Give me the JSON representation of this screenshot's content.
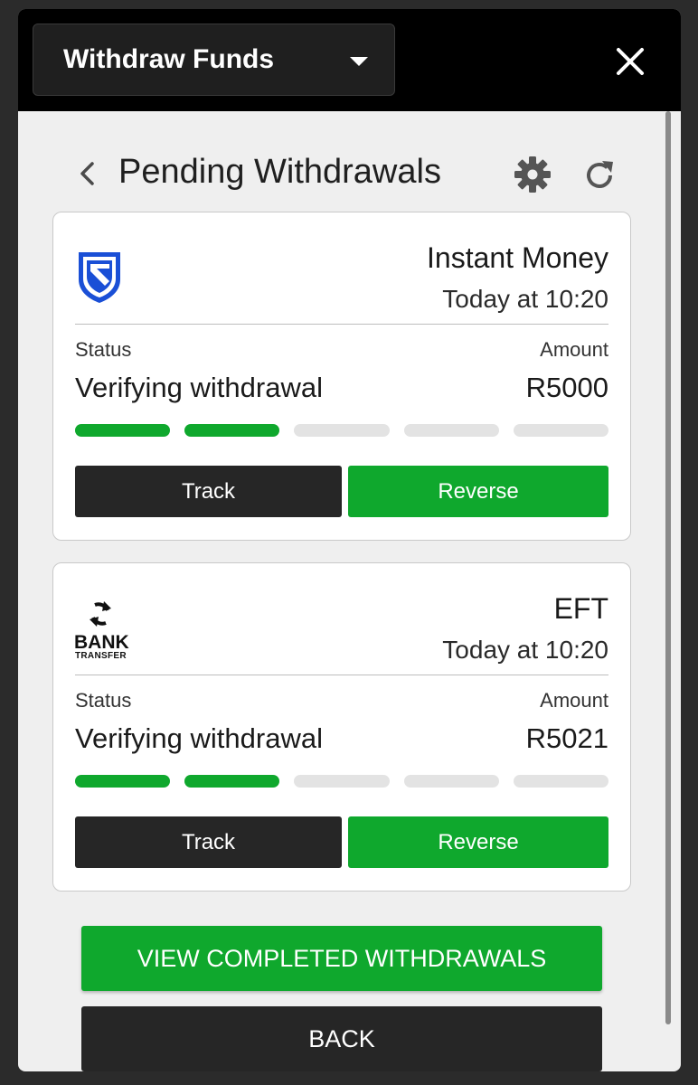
{
  "topbar": {
    "dropdown_label": "Withdraw Funds"
  },
  "header": {
    "title": "Pending Withdrawals"
  },
  "withdrawals": [
    {
      "method": "Instant Money",
      "time": "Today at 10:20",
      "status_label": "Status",
      "status": "Verifying withdrawal",
      "amount_label": "Amount",
      "amount": "R5000",
      "progress_steps_done": 2,
      "progress_steps_total": 5,
      "track_label": "Track",
      "reverse_label": "Reverse",
      "logo_icon": "shield-bank-icon"
    },
    {
      "method": "EFT",
      "time": "Today at 10:20",
      "status_label": "Status",
      "status": "Verifying withdrawal",
      "amount_label": "Amount",
      "amount": "R5021",
      "progress_steps_done": 2,
      "progress_steps_total": 5,
      "track_label": "Track",
      "reverse_label": "Reverse",
      "logo_icon": "bank-transfer-icon",
      "logo_text_main": "BANK",
      "logo_text_sub": "TRANSFER"
    }
  ],
  "buttons": {
    "view_completed": "VIEW COMPLETED WITHDRAWALS",
    "back": "BACK"
  },
  "colors": {
    "accent_green": "#0fa82d",
    "dark": "#262626",
    "bank_blue": "#1a4fd6"
  }
}
